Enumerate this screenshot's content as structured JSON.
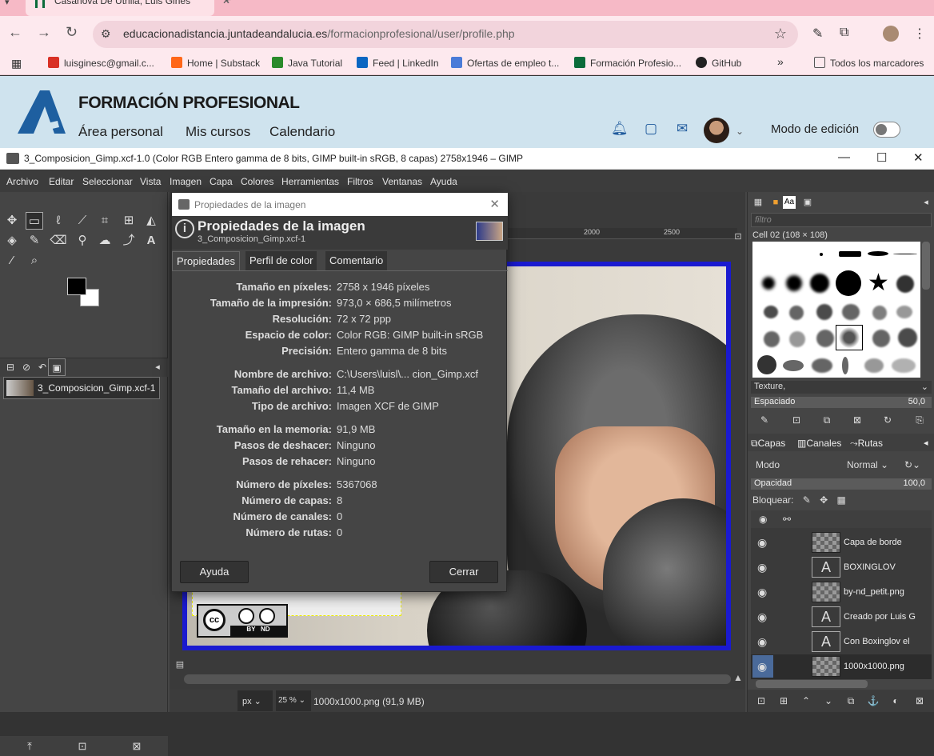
{
  "browser": {
    "tab_title": "Casanova De Utrilla, Luis Ginés",
    "url_host": "educacionadistancia.juntadeandalucia.es",
    "url_path": "/formacionprofesional/user/profile.php",
    "bookmarks": [
      {
        "label": "luisginesc@gmail.c...",
        "color": "#d93025"
      },
      {
        "label": "Home | Substack",
        "color": "#ff6719"
      },
      {
        "label": "Java Tutorial",
        "color": "#2a8a2a"
      },
      {
        "label": "Feed | LinkedIn",
        "color": "#0a66c2"
      },
      {
        "label": "Ofertas de empleo t...",
        "color": "#4a7bd8"
      },
      {
        "label": "Formación Profesio...",
        "color": "#0b6b3a"
      },
      {
        "label": "GitHub",
        "color": "#222222"
      }
    ],
    "all_bookmarks": "Todos los marcadores"
  },
  "moodle": {
    "title": "FORMACIÓN PROFESIONAL",
    "nav": [
      "Área personal",
      "Mis cursos",
      "Calendario"
    ],
    "edit_mode": "Modo de edición"
  },
  "gimp": {
    "window_title": "3_Composicion_Gimp.xcf-1.0 (Color RGB Entero gamma de 8 bits, GIMP built-in sRGB, 8 capas) 2758x1946 – GIMP",
    "menu": [
      "Archivo",
      "Editar",
      "Seleccionar",
      "Vista",
      "Imagen",
      "Capa",
      "Colores",
      "Herramientas",
      "Filtros",
      "Ventanas",
      "Ayuda"
    ],
    "image_item": "3_Composicion_Gimp.xcf-1",
    "ruler": [
      "2000",
      "2500"
    ],
    "unit": "px",
    "zoom": "25 %",
    "status": "1000x1000.png (91,9 MB)",
    "cc_label": "BY   ND"
  },
  "dock": {
    "filter_placeholder": "filtro",
    "brush_name": "Cell 02 (108 × 108)",
    "texture": "Texture,",
    "spacing_label": "Espaciado",
    "spacing_value": "50,0",
    "tabs": [
      "Capas",
      "Canales",
      "Rutas"
    ],
    "mode_label": "Modo",
    "mode_value": "Normal",
    "opacity_label": "Opacidad",
    "opacity_value": "100,0",
    "lock_label": "Bloquear:",
    "layers": [
      {
        "name": "Capa de borde",
        "thumb": "chk"
      },
      {
        "name": "BOXINGLOV",
        "thumb": "txt"
      },
      {
        "name": "by-nd_petit.png",
        "thumb": "chk"
      },
      {
        "name": "Creado por Luis G",
        "thumb": "txt"
      },
      {
        "name": "Con Boxinglov el",
        "thumb": "txt"
      },
      {
        "name": "1000x1000.png",
        "thumb": "chk"
      }
    ]
  },
  "dialog": {
    "title": "Propiedades de la imagen",
    "heading": "Propiedades de la imagen",
    "subheading": "3_Composicion_Gimp.xcf-1",
    "tabs": [
      "Propiedades",
      "Perfil de color",
      "Comentario"
    ],
    "rows": [
      {
        "k": "Tamaño en píxeles:",
        "v": "2758 x 1946 píxeles"
      },
      {
        "k": "Tamaño de la impresión:",
        "v": "973,0 × 686,5 milímetros"
      },
      {
        "k": "Resolución:",
        "v": "72 x 72 ppp"
      },
      {
        "k": "Espacio de color:",
        "v": "Color RGB: GIMP built-in sRGB"
      },
      {
        "k": "Precisión:",
        "v": "Entero gamma de 8 bits"
      },
      {
        "k": "Nombre de archivo:",
        "v": "C:\\Users\\luisl\\... cion_Gimp.xcf"
      },
      {
        "k": "Tamaño del archivo:",
        "v": "11,4 MB"
      },
      {
        "k": "Tipo de archivo:",
        "v": "Imagen XCF de GIMP"
      },
      {
        "k": "Tamaño en la memoria:",
        "v": "91,9 MB"
      },
      {
        "k": "Pasos de deshacer:",
        "v": "Ninguno"
      },
      {
        "k": "Pasos de rehacer:",
        "v": "Ninguno"
      },
      {
        "k": "Número de píxeles:",
        "v": "5367068"
      },
      {
        "k": "Número de capas:",
        "v": "8"
      },
      {
        "k": "Número de canales:",
        "v": "0"
      },
      {
        "k": "Número de rutas:",
        "v": "0"
      }
    ],
    "help_btn": "Ayuda",
    "close_btn": "Cerrar"
  }
}
